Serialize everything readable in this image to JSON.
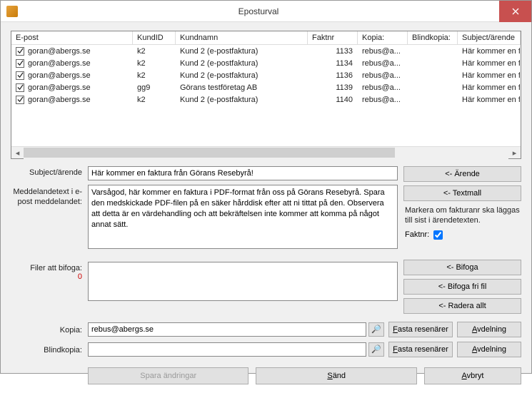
{
  "window": {
    "title": "Eposturval"
  },
  "columns": {
    "epost": "E-post",
    "kundid": "KundID",
    "kundnamn": "Kundnamn",
    "faktnr": "Faktnr",
    "kopia": "Kopia:",
    "blind": "Blindkopia:",
    "subject": "Subject/ärende"
  },
  "rows": [
    {
      "epost": "goran@abergs.se",
      "kundid": "k2",
      "kundnamn": "Kund 2 (e-postfaktura)",
      "faktnr": "1133",
      "kopia": "rebus@a...",
      "blind": "",
      "subject": "Här kommer en fa",
      "checked": true
    },
    {
      "epost": "goran@abergs.se",
      "kundid": "k2",
      "kundnamn": "Kund 2 (e-postfaktura)",
      "faktnr": "1134",
      "kopia": "rebus@a...",
      "blind": "",
      "subject": "Här kommer en fa",
      "checked": true
    },
    {
      "epost": "goran@abergs.se",
      "kundid": "k2",
      "kundnamn": "Kund 2 (e-postfaktura)",
      "faktnr": "1136",
      "kopia": "rebus@a...",
      "blind": "",
      "subject": "Här kommer en fa",
      "checked": true
    },
    {
      "epost": "goran@abergs.se",
      "kundid": "gg9",
      "kundnamn": "Görans testföretag AB",
      "faktnr": "1139",
      "kopia": "rebus@a...",
      "blind": "",
      "subject": "Här kommer en fa",
      "checked": true
    },
    {
      "epost": "goran@abergs.se",
      "kundid": "k2",
      "kundnamn": "Kund 2 (e-postfaktura)",
      "faktnr": "1140",
      "kopia": "rebus@a...",
      "blind": "",
      "subject": "Här kommer en fa",
      "checked": true
    }
  ],
  "labels": {
    "subject": "Subject/ärende",
    "messageText": "Meddelandetext i e-post meddelandet:",
    "files": "Filer att bifoga:",
    "zero": "0",
    "kopia": "Kopia:",
    "blind": "Blindkopia:"
  },
  "fields": {
    "subject": "Här kommer en faktura från Görans Resebyrå!",
    "message": "Varsågod, här kommer en faktura i PDF-format från oss på Görans Resebyrå. Spara den medskickade PDF-filen på en säker hårddisk efter att ni tittat på den. Observera att detta är en värdehandling och att bekräftelsen inte kommer att komma på något annat sätt.",
    "kopia": "rebus@abergs.se",
    "blind": ""
  },
  "buttons": {
    "arende": "<- Ärende",
    "textmall": "<- Textmall",
    "bifoga": "<- Bifoga",
    "bifogaFri": "<- Bifoga fri fil",
    "radera": "<- Radera allt",
    "fasta": "Fasta resenärer",
    "avdelning": "Avdelning",
    "spara": "Spara ändringar",
    "sand": "Sänd",
    "avbryt": "Avbryt"
  },
  "hint": "Markera om fakturanr ska läggas till sist i ärendetexten.",
  "faktnrLabel": "Faktnr:",
  "faktnrChecked": true,
  "accessKeys": {
    "fasta": "F",
    "avdelning": "A",
    "sand": "S",
    "avbryt": "A"
  }
}
